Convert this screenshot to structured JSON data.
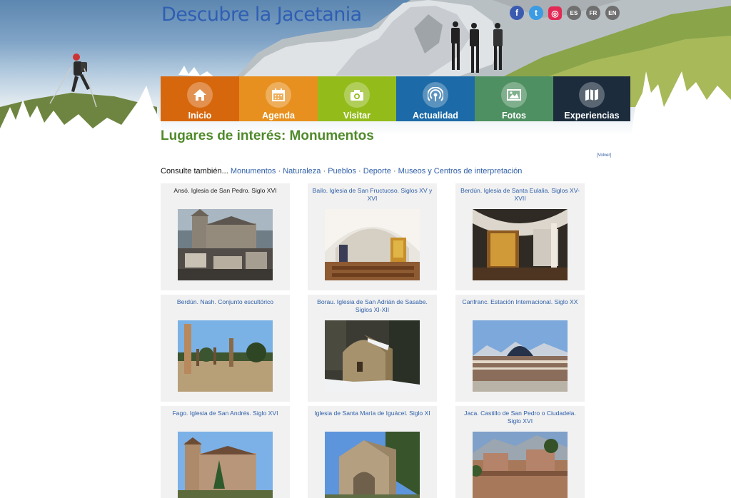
{
  "header": {
    "site_title": "Descubre la Jacetania",
    "social": [
      {
        "name": "facebook",
        "glyph": "f"
      },
      {
        "name": "twitter",
        "glyph": "t"
      },
      {
        "name": "instagram",
        "glyph": "◎"
      }
    ],
    "languages": [
      "ES",
      "FR",
      "EN"
    ]
  },
  "nav": [
    {
      "label": "Inicio",
      "icon": "home-icon",
      "color": "#d7670d"
    },
    {
      "label": "Agenda",
      "icon": "calendar-icon",
      "color": "#e8901f"
    },
    {
      "label": "Visitar",
      "icon": "camera-icon",
      "color": "#93bc1b"
    },
    {
      "label": "Actualidad",
      "icon": "broadcast-icon",
      "color": "#1c6aa7"
    },
    {
      "label": "Fotos",
      "icon": "image-icon",
      "color": "#4f9062"
    },
    {
      "label": "Experiencias",
      "icon": "map-icon",
      "color": "#1c2c3d"
    }
  ],
  "content": {
    "title": "Lugares de interés: Monumentos",
    "back_label": "[Volver]",
    "consulte_prefix": "Consulte también...",
    "consulte_links": [
      "Monumentos",
      "Naturaleza",
      "Pueblos",
      "Deporte",
      "Museos y Centros de interpretación"
    ],
    "separator": " · "
  },
  "cards": [
    {
      "title": "Ansó. Iglesia de San Pedro. Siglo XVI",
      "image": "church-village-photo"
    },
    {
      "title": "Bailo. Iglesia de San Fructuoso. Siglos XV y XVI",
      "image": "church-interior-photo"
    },
    {
      "title": "Berdún. Iglesia de Santa Eulalia. Siglos XV-XVII",
      "image": "altar-interior-photo"
    },
    {
      "title": "Berdún. Nash. Conjunto escultórico",
      "image": "sculpture-field-photo"
    },
    {
      "title": "Borau. Iglesia de San Adrián de Sasabe. Siglos XI-XII",
      "image": "romanesque-church-snow-photo"
    },
    {
      "title": "Canfranc. Estación Internacional. Siglo XX",
      "image": "train-station-photo"
    },
    {
      "title": "Fago. Iglesia de San Andrés. Siglo XVI",
      "image": "village-church-photo"
    },
    {
      "title": "Iglesia de Santa María de Iguácel. Siglo XI",
      "image": "stone-church-photo"
    },
    {
      "title": "Jaca. Castillo de San Pedro o Ciudadela. Siglo XVI",
      "image": "citadel-photo"
    }
  ]
}
